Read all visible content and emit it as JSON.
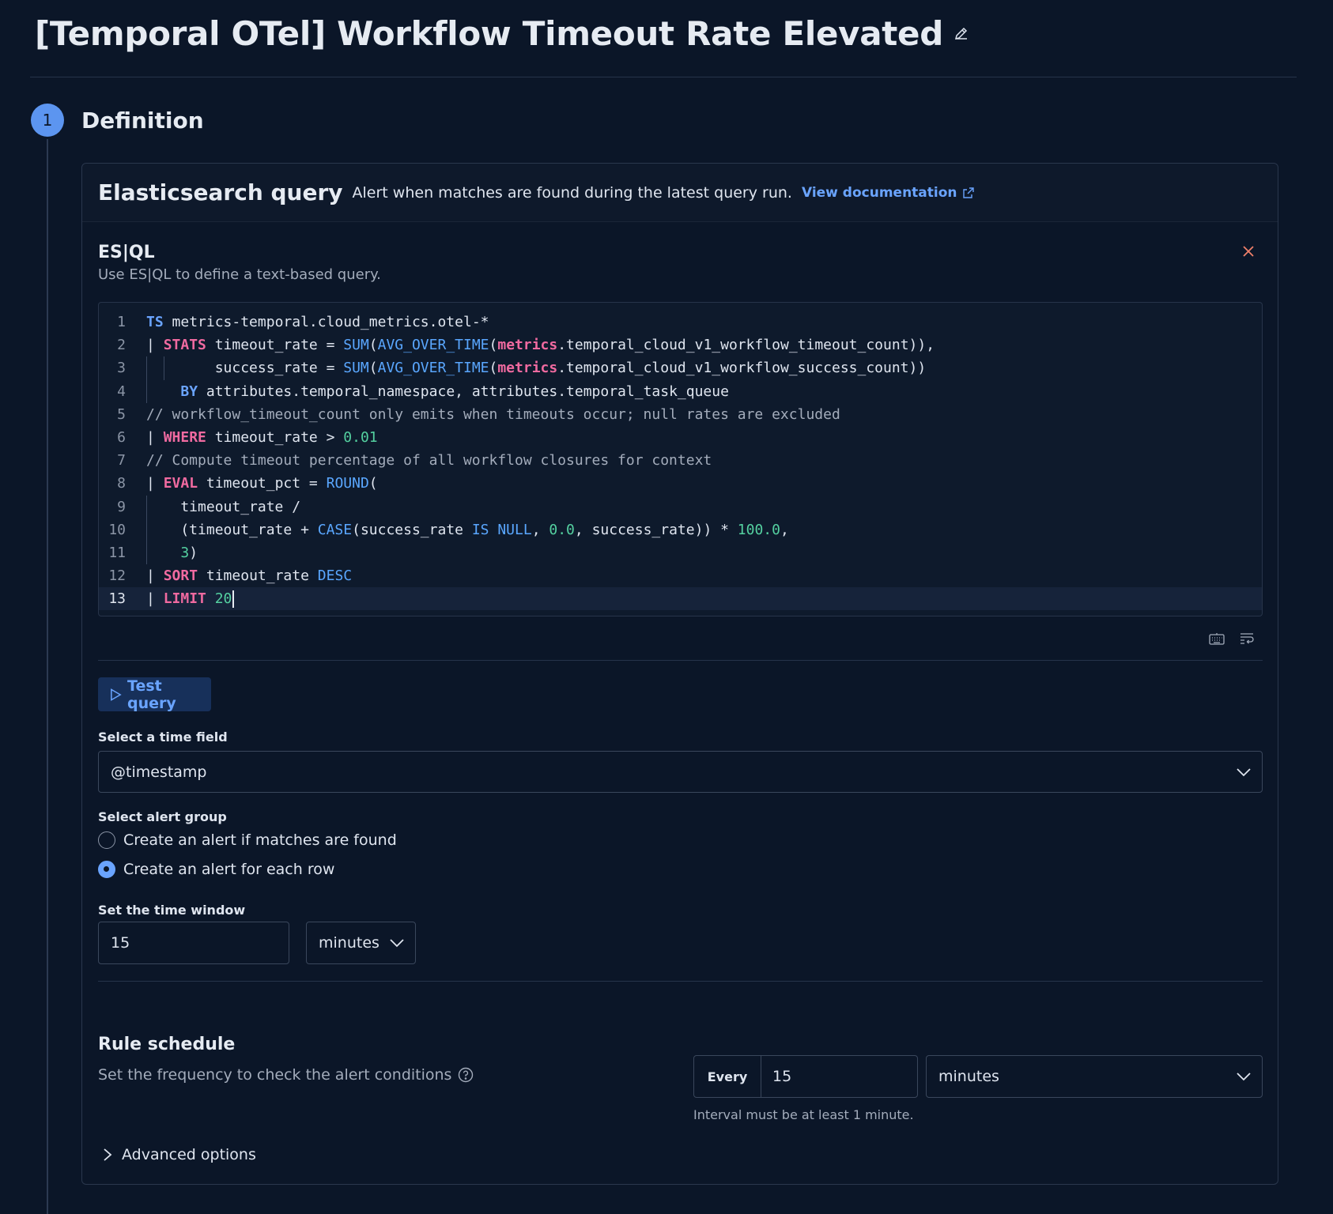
{
  "header": {
    "title": "[Temporal OTel] Workflow Timeout Rate Elevated"
  },
  "step": {
    "number": "1",
    "title": "Definition"
  },
  "rule_type": {
    "title": "Elasticsearch query",
    "description": "Alert when matches are found during the latest query run.",
    "doc_link": "View documentation"
  },
  "esql": {
    "title": "ES|QL",
    "description": "Use ES|QL to define a text-based query.",
    "lines": [
      [
        {
          "t": "TS",
          "c": "kw2"
        },
        {
          "t": " metrics-temporal.cloud_metrics.otel-*",
          "c": "op"
        }
      ],
      [
        {
          "t": "| ",
          "c": "op"
        },
        {
          "t": "STATS",
          "c": "kw"
        },
        {
          "t": " timeout_rate = ",
          "c": "op"
        },
        {
          "t": "SUM",
          "c": "fn"
        },
        {
          "t": "(",
          "c": "op"
        },
        {
          "t": "AVG_OVER_TIME",
          "c": "fn"
        },
        {
          "t": "(",
          "c": "op"
        },
        {
          "t": "metrics",
          "c": "kw"
        },
        {
          "t": ".temporal_cloud_v1_workflow_timeout_count)),",
          "c": "op"
        }
      ],
      [
        {
          "t": "        success_rate = ",
          "c": "op"
        },
        {
          "t": "SUM",
          "c": "fn"
        },
        {
          "t": "(",
          "c": "op"
        },
        {
          "t": "AVG_OVER_TIME",
          "c": "fn"
        },
        {
          "t": "(",
          "c": "op"
        },
        {
          "t": "metrics",
          "c": "kw"
        },
        {
          "t": ".temporal_cloud_v1_workflow_success_count))",
          "c": "op"
        }
      ],
      [
        {
          "t": "    ",
          "c": "op"
        },
        {
          "t": "BY",
          "c": "kw2"
        },
        {
          "t": " attributes.temporal_namespace, attributes.temporal_task_queue",
          "c": "op"
        }
      ],
      [
        {
          "t": "// workflow_timeout_count only emits when timeouts occur; null rates are excluded",
          "c": "cmt"
        }
      ],
      [
        {
          "t": "| ",
          "c": "op"
        },
        {
          "t": "WHERE",
          "c": "kw"
        },
        {
          "t": " timeout_rate > ",
          "c": "op"
        },
        {
          "t": "0.01",
          "c": "num"
        }
      ],
      [
        {
          "t": "// Compute timeout percentage of all workflow closures for context",
          "c": "cmt"
        }
      ],
      [
        {
          "t": "| ",
          "c": "op"
        },
        {
          "t": "EVAL",
          "c": "kw"
        },
        {
          "t": " timeout_pct = ",
          "c": "op"
        },
        {
          "t": "ROUND",
          "c": "fn"
        },
        {
          "t": "(",
          "c": "op"
        }
      ],
      [
        {
          "t": "    timeout_rate /",
          "c": "op"
        }
      ],
      [
        {
          "t": "    (timeout_rate + ",
          "c": "op"
        },
        {
          "t": "CASE",
          "c": "fn"
        },
        {
          "t": "(success_rate ",
          "c": "op"
        },
        {
          "t": "IS NULL",
          "c": "fn"
        },
        {
          "t": ", ",
          "c": "op"
        },
        {
          "t": "0.0",
          "c": "num"
        },
        {
          "t": ", success_rate)) * ",
          "c": "op"
        },
        {
          "t": "100.0",
          "c": "num"
        },
        {
          "t": ",",
          "c": "op"
        }
      ],
      [
        {
          "t": "    ",
          "c": "op"
        },
        {
          "t": "3",
          "c": "num"
        },
        {
          "t": ")",
          "c": "op"
        }
      ],
      [
        {
          "t": "| ",
          "c": "op"
        },
        {
          "t": "SORT",
          "c": "kw"
        },
        {
          "t": " timeout_rate ",
          "c": "op"
        },
        {
          "t": "DESC",
          "c": "fn"
        }
      ],
      [
        {
          "t": "| ",
          "c": "op"
        },
        {
          "t": "LIMIT",
          "c": "kw"
        },
        {
          "t": " ",
          "c": "op"
        },
        {
          "t": "20",
          "c": "num"
        }
      ]
    ],
    "line_numbers": [
      "1",
      "2",
      "3",
      "4",
      "5",
      "6",
      "7",
      "8",
      "9",
      "10",
      "11",
      "12",
      "13"
    ]
  },
  "test_button": {
    "label": "Test query"
  },
  "time_field": {
    "label": "Select a time field",
    "value": "@timestamp"
  },
  "alert_group": {
    "label": "Select alert group",
    "options": [
      {
        "label": "Create an alert if matches are found",
        "checked": false
      },
      {
        "label": "Create an alert for each row",
        "checked": true
      }
    ]
  },
  "time_window": {
    "label": "Set the time window",
    "value": "15",
    "unit": "minutes"
  },
  "schedule": {
    "title": "Rule schedule",
    "description": "Set the frequency to check the alert conditions",
    "prefix": "Every",
    "value": "15",
    "unit": "minutes",
    "help": "Interval must be at least 1 minute."
  },
  "advanced": {
    "label": "Advanced options"
  },
  "colors": {
    "background": "#0b1628",
    "accent": "#6aa4ff",
    "step_circle": "#5c95f0",
    "close": "#f0806a"
  }
}
